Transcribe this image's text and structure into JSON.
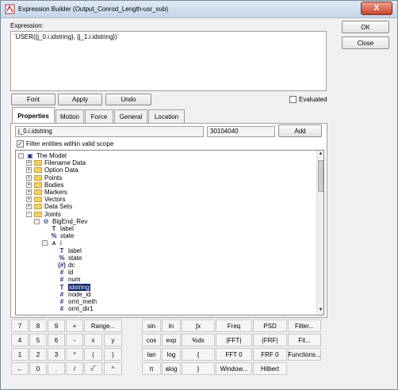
{
  "window": {
    "title": "Expression Builder (Output_Conrod_Length-usr_sub)",
    "close_label": "X"
  },
  "expression": {
    "label": "Expression:",
    "value": "`USER({j_0.i.idstring}, {j_1.i.idstring})`"
  },
  "dialog_buttons": {
    "ok": "OK",
    "close": "Close"
  },
  "toolbar": {
    "font": "Font",
    "apply": "Apply",
    "undo": "Undo",
    "evaluated_label": "Evaluated",
    "evaluated_checked": false
  },
  "tabs": [
    "Properties",
    "Motion",
    "Force",
    "General",
    "Location"
  ],
  "active_tab": "Properties",
  "properties": {
    "path_value": "j_0.i.idstring",
    "id_value": "30104040",
    "add_label": "Add",
    "filter_label": "Filter entities within valid scope",
    "filter_checked": true
  },
  "tree": [
    {
      "label": "The Model",
      "icon": "model-icon",
      "exp": "-"
    },
    {
      "label": "Filename Data",
      "icon": "folder-icon",
      "exp": "+"
    },
    {
      "label": "Option Data",
      "icon": "folder-icon",
      "exp": "+"
    },
    {
      "label": "Points",
      "icon": "folder-icon",
      "exp": "+"
    },
    {
      "label": "Bodies",
      "icon": "folder-icon",
      "exp": "+"
    },
    {
      "label": "Markers",
      "icon": "folder-icon",
      "exp": "+"
    },
    {
      "label": "Vectors",
      "icon": "folder-icon",
      "exp": "+"
    },
    {
      "label": "Data Sets",
      "icon": "folder-icon",
      "exp": "+"
    },
    {
      "label": "Joints",
      "icon": "folder-icon",
      "exp": "-"
    },
    {
      "label": "BigEnd_Rev",
      "icon": "joint-icon",
      "exp": "-"
    },
    {
      "label": "label",
      "icon": "text-icon",
      "exp": ""
    },
    {
      "label": "state",
      "icon": "state-icon",
      "exp": ""
    },
    {
      "label": "i",
      "icon": "marker-icon",
      "exp": "-"
    },
    {
      "label": "label",
      "icon": "text-icon",
      "exp": ""
    },
    {
      "label": "state",
      "icon": "state-icon",
      "exp": ""
    },
    {
      "label": "dc",
      "icon": "dc-icon",
      "exp": ""
    },
    {
      "label": "id",
      "icon": "number-icon",
      "exp": ""
    },
    {
      "label": "num",
      "icon": "number-icon",
      "exp": ""
    },
    {
      "label": "idstring",
      "icon": "text-icon",
      "exp": "",
      "selected": true
    },
    {
      "label": "node_id",
      "icon": "number-icon",
      "exp": ""
    },
    {
      "label": "ornt_meth",
      "icon": "number-icon",
      "exp": ""
    },
    {
      "label": "ornt_dir1",
      "icon": "number-icon",
      "exp": ""
    }
  ],
  "keypad": [
    [
      "7",
      "8",
      "9",
      "+",
      "Range...",
      "sin",
      "ln",
      "∫x",
      "Freq",
      "PSD",
      "Filter..."
    ],
    [
      "4",
      "5",
      "6",
      "-",
      "x",
      "y",
      "cos",
      "exp",
      "%dx",
      "|FFT|",
      "|FRF|",
      "Fit..."
    ],
    [
      "1",
      "2",
      "3",
      "*",
      "(",
      ")",
      "tan",
      "log",
      "{",
      "FFT 0",
      "FRF 0",
      "Functions..."
    ],
    [
      "←",
      "0",
      ".",
      "/",
      "√‾",
      "^",
      "π",
      "alog",
      "}",
      "Window...",
      "Hilbert"
    ]
  ]
}
